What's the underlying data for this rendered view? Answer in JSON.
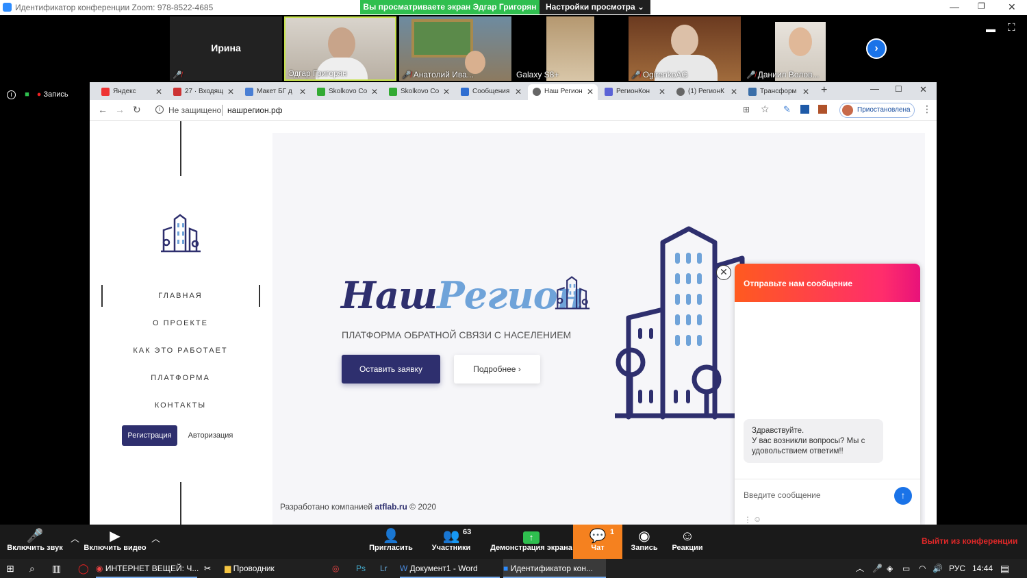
{
  "zoom": {
    "window_title": "Идентификатор конференции Zoom: 978-8522-4685",
    "share_banner": "Вы просматриваете экран Эдгар Григорян",
    "view_options": "Настройки просмотра",
    "recording_label": "Запись",
    "participants": [
      {
        "name": "Ирина"
      },
      {
        "name": "Эдгар Григорян"
      },
      {
        "name": "Анатолий Ива..."
      },
      {
        "name": "Galaxy S8+"
      },
      {
        "name": "OgirenkoAG"
      },
      {
        "name": "Даниил Волов..."
      }
    ],
    "toolbar": {
      "unmute": "Включить звук",
      "start_video": "Включить видео",
      "invite": "Пригласить",
      "participants": "Участники",
      "participants_count": "63",
      "share_screen": "Демонстрация экрана",
      "chat": "Чат",
      "chat_badge": "1",
      "record": "Запись",
      "reactions": "Реакции",
      "leave": "Выйти из конференции"
    }
  },
  "browser": {
    "tabs": [
      {
        "label": "Яндекс",
        "color": "#e33"
      },
      {
        "label": "27 · Входящ",
        "color": "#c33"
      },
      {
        "label": "Макет БГ д",
        "color": "#4a7fd4"
      },
      {
        "label": "Skolkovo Co",
        "color": "#3a3"
      },
      {
        "label": "Skolkovo Co",
        "color": "#3a3"
      },
      {
        "label": "Сообщения",
        "color": "#2f6ed1"
      },
      {
        "label": "Наш Регион",
        "color": "#666"
      },
      {
        "label": "РегионКон",
        "color": "#5b63d6"
      },
      {
        "label": "(1) РегионК",
        "color": "#666"
      },
      {
        "label": "Трансформ",
        "color": "#3a6ea8"
      }
    ],
    "security": "Не защищено",
    "url": "нашрегион.рф",
    "profile_status": "Приостановлена"
  },
  "site": {
    "nav": [
      "ГЛАВНАЯ",
      "О ПРОЕКТЕ",
      "КАК ЭТО РАБОТАЕТ",
      "ПЛАТФОРМА",
      "КОНТАКТЫ"
    ],
    "register": "Регистрация",
    "login": "Авторизация",
    "logo_part1": "Наш",
    "logo_part2": "Регион",
    "subtitle": "ПЛАТФОРМА ОБРАТНОЙ СВЯЗИ С НАСЕЛЕНИЕМ",
    "cta_primary": "Оставить заявку",
    "cta_secondary": "Подробнее",
    "footer_prefix": "Разработано компанией",
    "footer_company": "atflab.ru",
    "footer_suffix": "© 2020",
    "colors": {
      "navy": "#2e2f6e",
      "blue": "#6fa3d9"
    }
  },
  "chat": {
    "header": "Отправьте нам сообщение",
    "message_line1": "Здравствуйте.",
    "message_line2": "У вас возникли вопросы? Мы с удовольствием ответим!!",
    "input_placeholder": "Введите сообщение"
  },
  "taskbar": {
    "items": [
      "ИНТЕРНЕТ ВЕЩЕЙ: Ч...",
      "Проводник",
      "Документ1 - Word",
      "Идентификатор кон..."
    ],
    "lang": "РУС",
    "time": "14:44"
  }
}
